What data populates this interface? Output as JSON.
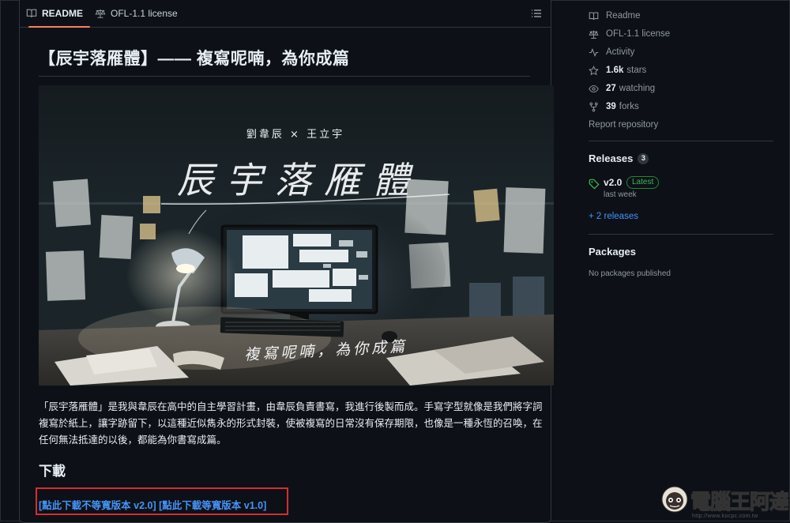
{
  "tabs": {
    "readme": "README",
    "license": "OFL-1.1 license"
  },
  "readme": {
    "title": "【辰宇落雁體】—— 複寫呢喃，為你成篇",
    "banner": {
      "authors": "劉韋辰 × 王立宇",
      "calligraphy_title": "辰宇落雁體",
      "calligraphy_subtitle": "複寫呢喃，為你成篇"
    },
    "description": "「辰宇落雁體」是我與韋辰在高中的自主學習計畫，由韋辰負責書寫，我進行後製而成。手寫字型就像是我們將字詞複寫於紙上，讓字跡留下，以這種近似雋永的形式封裝，使被複寫的日常沒有保存期限，也像是一種永恆的召喚，在任何無法抵達的以後，都能為你書寫成篇。",
    "download_heading": "下載",
    "download_link_1": "[點此下載不等寬版本 v2.0]",
    "download_link_2": "[點此下載等寬版本 v1.0]"
  },
  "sidebar": {
    "readme": "Readme",
    "license": "OFL-1.1 license",
    "activity": "Activity",
    "stars_count": "1.6k",
    "stars_label": "stars",
    "watching_count": "27",
    "watching_label": "watching",
    "forks_count": "39",
    "forks_label": "forks",
    "report": "Report repository",
    "releases_heading": "Releases",
    "releases_count": "3",
    "release_version": "v2.0",
    "release_badge": "Latest",
    "release_date": "last week",
    "more_releases": "+ 2 releases",
    "packages_heading": "Packages",
    "no_packages": "No packages published"
  },
  "watermark": {
    "text": "電腦王阿達",
    "url": "http://www.kocpc.com.tw"
  },
  "colors": {
    "accent_tab": "#f78166",
    "link": "#4493f8",
    "latest_green": "#3fb950",
    "highlight_box": "#d32f2f"
  }
}
